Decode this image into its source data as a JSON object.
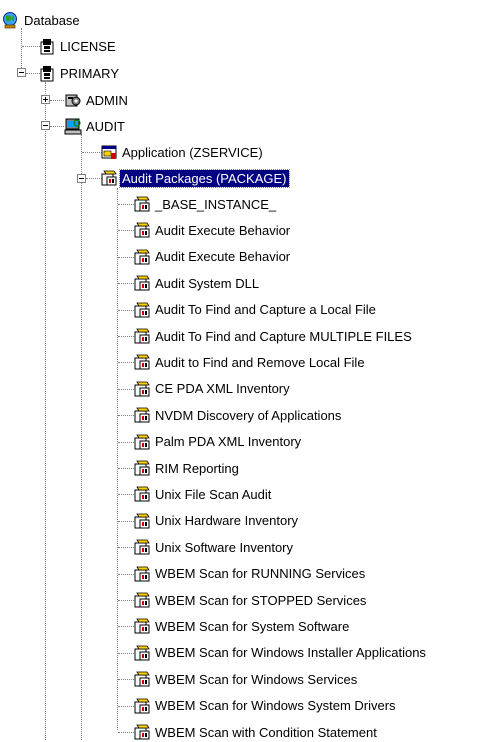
{
  "tree": {
    "root": {
      "label": "Database",
      "icon": "database-globe-icon"
    },
    "license": {
      "label": "LICENSE",
      "icon": "file-cabinet-icon"
    },
    "primary": {
      "label": "PRIMARY",
      "icon": "file-cabinet-icon",
      "expanded": true
    },
    "admin": {
      "label": "ADMIN",
      "icon": "admin-gear-icon",
      "expanded": false
    },
    "audit": {
      "label": "AUDIT",
      "icon": "audit-computer-icon",
      "expanded": true
    },
    "application": {
      "label": "Application (ZSERVICE)",
      "icon": "application-instance-icon"
    },
    "audit_packages": {
      "label": "Audit Packages (PACKAGE)",
      "icon": "package-instance-icon",
      "expanded": true,
      "selected": true
    },
    "packages": [
      {
        "label": "_BASE_INSTANCE_",
        "icon": "package-instance-icon"
      },
      {
        "label": "Audit Execute Behavior",
        "icon": "package-instance-icon"
      },
      {
        "label": "Audit Execute Behavior",
        "icon": "package-instance-icon"
      },
      {
        "label": "Audit System DLL",
        "icon": "package-instance-icon"
      },
      {
        "label": "Audit To Find and Capture a Local File",
        "icon": "package-instance-icon"
      },
      {
        "label": "Audit To Find and Capture MULTIPLE FILES",
        "icon": "package-instance-icon"
      },
      {
        "label": "Audit to Find and Remove Local File",
        "icon": "package-instance-icon"
      },
      {
        "label": "CE PDA XML Inventory",
        "icon": "package-instance-icon"
      },
      {
        "label": "NVDM Discovery of Applications",
        "icon": "package-instance-icon"
      },
      {
        "label": "Palm PDA XML Inventory",
        "icon": "package-instance-icon"
      },
      {
        "label": "RIM Reporting",
        "icon": "package-instance-icon"
      },
      {
        "label": "Unix File Scan Audit",
        "icon": "package-instance-icon"
      },
      {
        "label": "Unix Hardware Inventory",
        "icon": "package-instance-icon"
      },
      {
        "label": "Unix Software Inventory",
        "icon": "package-instance-icon"
      },
      {
        "label": "WBEM Scan for RUNNING Services",
        "icon": "package-instance-icon"
      },
      {
        "label": "WBEM Scan for STOPPED Services",
        "icon": "package-instance-icon"
      },
      {
        "label": "WBEM Scan for System Software",
        "icon": "package-instance-icon"
      },
      {
        "label": "WBEM Scan for Windows Installer Applications",
        "icon": "package-instance-icon"
      },
      {
        "label": "WBEM Scan for Windows Services",
        "icon": "package-instance-icon"
      },
      {
        "label": "WBEM Scan for Windows System Drivers",
        "icon": "package-instance-icon"
      },
      {
        "label": "WBEM Scan with Condition Statement",
        "icon": "package-instance-icon"
      }
    ]
  },
  "colors": {
    "selection": "#000080",
    "tree_lines": "#808080"
  }
}
